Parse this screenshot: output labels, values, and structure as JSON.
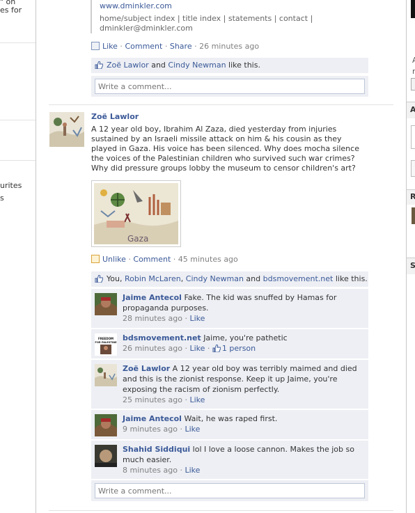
{
  "left_column": {
    "frag_1": "\" on",
    "frag_2": "es for",
    "frag_3": "urites",
    "frag_4": "s"
  },
  "previous_story": {
    "link": "www.dmink­ler.com",
    "nav": "home/subject index | title index | statements | contact |",
    "email": "dminkler@dminkler.com",
    "actions": {
      "like": "Like",
      "comment": "Comment",
      "share": "Share",
      "time": "26 minutes ago"
    },
    "likes": {
      "name1": "Zoë Lawlor",
      "and": "and",
      "name2": "Cindy Newman",
      "suffix": "like this."
    },
    "comment_placeholder": "Write a comment..."
  },
  "story": {
    "author": "Zoë Lawlor",
    "text": "A 12 year old boy, Ibrahim Al Zaza, died yesterday from injuries sustained by an Israeli missile attack on him & his cousin as they played in Gaza. His voice has been silenced. Why does mocha silence the voices of the Palestinian children who survived such war crimes? Why did pressure groups lobby the museum to censor children's art?",
    "photo_caption": "Gaza",
    "actions": {
      "unlike": "Unlike",
      "comment": "Comment",
      "time": "45 minutes ago"
    },
    "likes": {
      "you": "You,",
      "name1": "Robin McLaren",
      "name2": "Cindy Newman",
      "and": "and",
      "name3": "bdsmovement.net",
      "suffix": "like this."
    },
    "comments": [
      {
        "author": "Jaime Antecol",
        "text": "Fake. The kid was snuffed by Hamas for propaganda purposes.",
        "time": "28 minutes ago",
        "like": "Like"
      },
      {
        "author": "bdsmovement.net",
        "text": "Jaime, you're pathetic",
        "time": "26 minutes ago",
        "like": "Like",
        "likes_count": "1 person",
        "avatar_text": "FREEDOM FOR PALESTINE"
      },
      {
        "author": "Zoë Lawlor",
        "text": "A 12 year old boy was terribly maimed and died and this is the zionist response. Keep it up Jaime, you're exposing the racism of zionism perfectly.",
        "time": "25 minutes ago",
        "like": "Like"
      },
      {
        "author": "Jaime Antecol",
        "text": "Wait, he was raped first.",
        "time": "9 minutes ago",
        "like": "Like"
      },
      {
        "author": "Shahid Siddiqui",
        "text": "lol I love a loose cannon. Makes the job so much easier.",
        "time": "8 minutes ago",
        "like": "Like"
      }
    ],
    "comment_placeholder": "Write a comment..."
  },
  "right_column": {
    "frag_a": "A",
    "frag_r": "r",
    "frag_A2": "A",
    "frag_R": "R",
    "frag_S": "S"
  },
  "colors": {
    "link": "#3b5998",
    "bar": "#edeff4",
    "border": "#bdc7d8"
  }
}
